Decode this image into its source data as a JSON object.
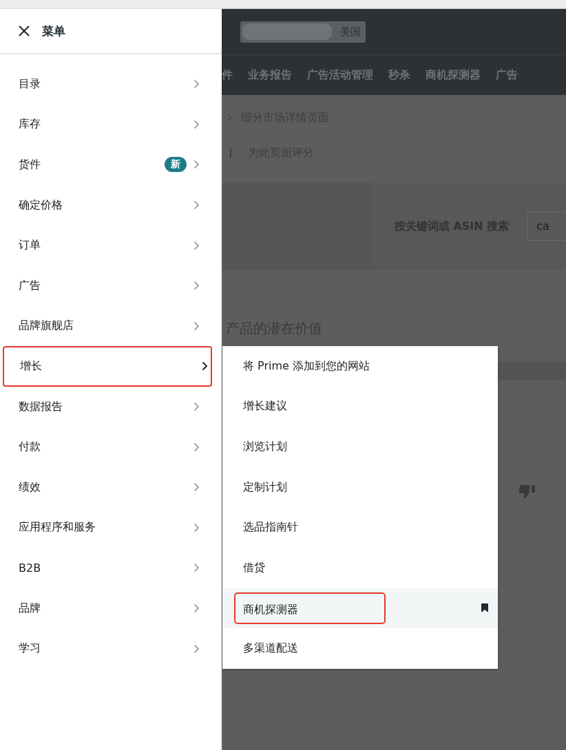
{
  "background_page": {
    "store_selector": {
      "value": "美国"
    },
    "nav_items": [
      "件",
      "业务报告",
      "广告活动管理",
      "秒杀",
      "商机探测器",
      "广告"
    ],
    "breadcrumb": "细分市场详情页面",
    "rate_link": "为此页面评分",
    "search": {
      "label": "按关键词或 ASIN 搜索",
      "value": "ca"
    },
    "section_heading": "产品的潜在价值"
  },
  "sidebar": {
    "title": "菜单",
    "items": [
      {
        "label": "目录",
        "selected": false
      },
      {
        "label": "库存",
        "selected": false
      },
      {
        "label": "货件",
        "badge": "新",
        "selected": false
      },
      {
        "label": "确定价格",
        "selected": false
      },
      {
        "label": "订单",
        "selected": false
      },
      {
        "label": "广告",
        "selected": false
      },
      {
        "label": "品牌旗舰店",
        "selected": false
      },
      {
        "label": "增长",
        "selected": true
      },
      {
        "label": "数据报告",
        "selected": false
      },
      {
        "label": "付款",
        "selected": false
      },
      {
        "label": "绩效",
        "selected": false
      },
      {
        "label": "应用程序和服务",
        "selected": false
      },
      {
        "label": "B2B",
        "selected": false
      },
      {
        "label": "品牌",
        "selected": false
      },
      {
        "label": "学习",
        "selected": false
      }
    ]
  },
  "submenu": {
    "items": [
      {
        "label": "将 Prime 添加到您的网站",
        "selected": false,
        "bookmarked": false
      },
      {
        "label": "增长建议",
        "selected": false,
        "bookmarked": false
      },
      {
        "label": "浏览计划",
        "selected": false,
        "bookmarked": false
      },
      {
        "label": "定制计划",
        "selected": false,
        "bookmarked": false
      },
      {
        "label": "选品指南针",
        "selected": false,
        "bookmarked": false
      },
      {
        "label": "借贷",
        "selected": false,
        "bookmarked": false
      },
      {
        "label": "商机探测器",
        "selected": true,
        "bookmarked": true
      },
      {
        "label": "多渠道配送",
        "selected": false,
        "bookmarked": false
      }
    ]
  }
}
